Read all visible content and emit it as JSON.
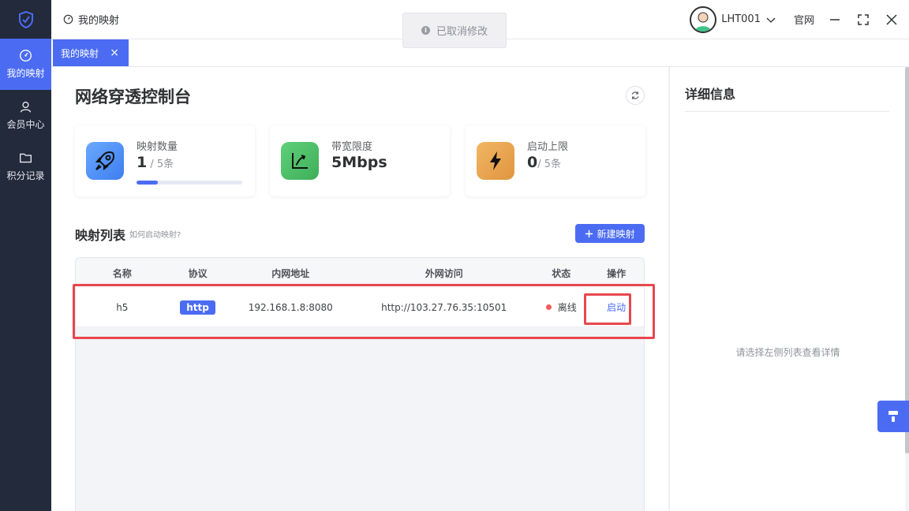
{
  "sidebar": {
    "items": [
      {
        "label": "我的映射",
        "icon": "dashboard-icon",
        "active": true
      },
      {
        "label": "会员中心",
        "icon": "user-icon",
        "active": false
      },
      {
        "label": "积分记录",
        "icon": "folder-icon",
        "active": false
      }
    ]
  },
  "header": {
    "breadcrumb": "我的映射",
    "username": "LHT001",
    "site_link": "官网"
  },
  "toast": {
    "message": "已取消修改"
  },
  "tabs": [
    {
      "label": "我的映射",
      "close": "×"
    }
  ],
  "main": {
    "title": "网络穿透控制台",
    "stats": [
      {
        "label": "映射数量",
        "value": "1",
        "suffix": " / 5条",
        "progress": 0.2,
        "color": "#4b8bf5"
      },
      {
        "label": "带宽限度",
        "value": "5Mbps",
        "suffix": "",
        "color": "#4fc068"
      },
      {
        "label": "启动上限",
        "value": "0",
        "suffix": "/ 5条",
        "color": "#e9a04a"
      }
    ],
    "list": {
      "title": "映射列表",
      "hint": "如何启动映射?",
      "new_button": "新建映射",
      "columns": [
        "名称",
        "协议",
        "内网地址",
        "外网访问",
        "状态",
        "操作"
      ],
      "rows": [
        {
          "name": "h5",
          "protocol": "http",
          "local": "192.168.1.8:8080",
          "public": "http://103.27.76.35:10501",
          "status": "离线",
          "action": "启动"
        }
      ]
    }
  },
  "detail": {
    "title": "详细信息",
    "empty": "请选择左侧列表查看详情"
  },
  "colors": {
    "accent": "#4b6cf2",
    "sidebar": "#232a3c",
    "offline": "#f35b5b",
    "highlight": "#e8474e"
  }
}
